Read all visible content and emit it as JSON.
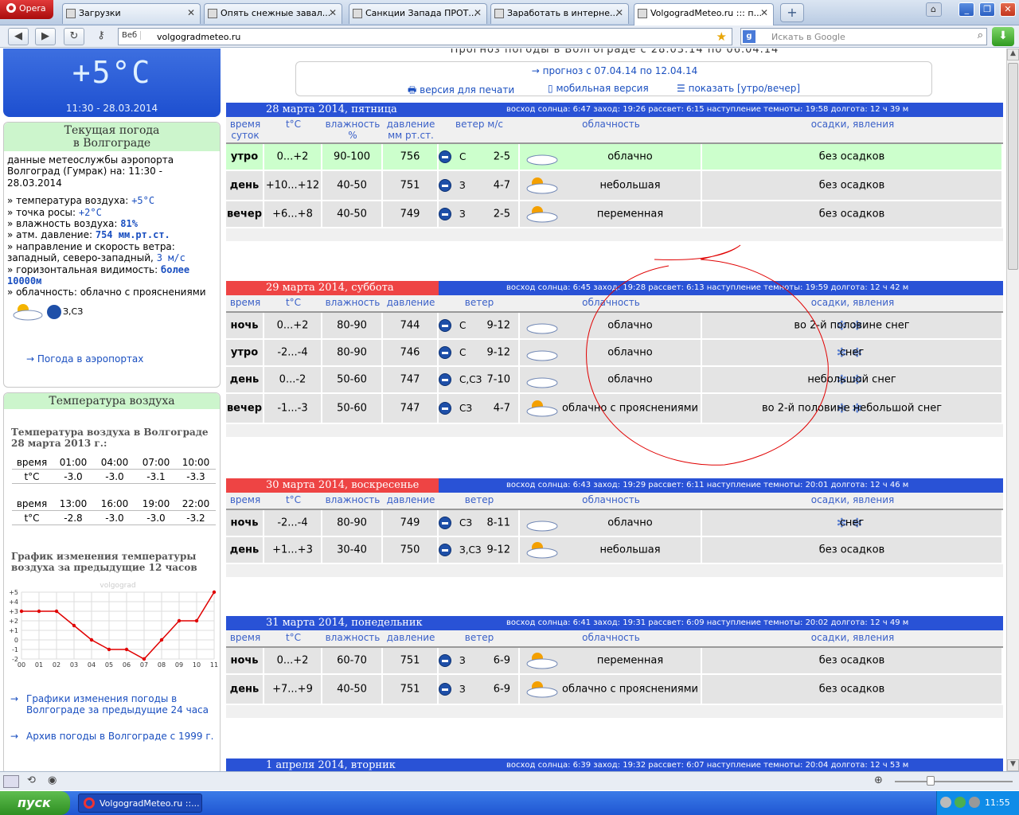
{
  "browser": {
    "opera_label": "Opera",
    "tabs": [
      {
        "title": "Загрузки",
        "active": false
      },
      {
        "title": "Опять снежные завал...",
        "active": false
      },
      {
        "title": "Санкции Запада ПРОТ...",
        "active": false
      },
      {
        "title": "Заработать в интерне...",
        "active": false
      },
      {
        "title": "VolgogradMeteo.ru ::: п...",
        "active": true
      }
    ],
    "web_label": "Веб",
    "url": "volgogradmeteo.ru",
    "search_placeholder": "Искать в Google"
  },
  "page": {
    "top_title": "Прогноз погоды в Волгограде с 28.03.14 по 06.04.14",
    "forecast_next_link": "прогноз с 07.04.14 по 12.04.14",
    "print_link": "версия для печати",
    "mobile_link": "мобильная версия",
    "show_link": "показать [утро/вечер]"
  },
  "current": {
    "big_temp": "+5°C",
    "big_time": "11:30 - 28.03.2014",
    "box_title_1": "Текущая погода",
    "box_title_2": "в Волгограде",
    "source": "данные метеослужбы аэропорта Волгоград (Гумрак) на: 11:30 - 28.03.2014",
    "air_temp_label": "температура воздуха:",
    "air_temp_value": "+5°C",
    "dew_label": "точка росы:",
    "dew_value": "+2°C",
    "humidity_label": "влажность воздуха:",
    "humidity_value": "81%",
    "pressure_label": "атм. давление:",
    "pressure_value": "754 мм.рт.ст.",
    "wind_label": "направление и скорость ветра:",
    "wind_text": "западный, северо-западный,",
    "wind_value": "3 м/с",
    "visibility_label": "горизонтальная видимость:",
    "visibility_value": "более 10000м",
    "cloud_label": "облачность: облачно с прояснениями",
    "wind_dir_short": "З,СЗ",
    "airports_link": "Погода в аэропортах"
  },
  "temp_history": {
    "box_title": "Температура воздуха",
    "subtitle": "Температура воздуха в Волгограде 28 марта 2013 г.:",
    "rows": [
      {
        "label": "время",
        "values": [
          "01:00",
          "04:00",
          "07:00",
          "10:00"
        ]
      },
      {
        "label": "t°C",
        "values": [
          "-3.0",
          "-3.0",
          "-3.1",
          "-3.3"
        ]
      },
      {
        "label": "время",
        "values": [
          "13:00",
          "16:00",
          "19:00",
          "22:00"
        ]
      },
      {
        "label": "t°C",
        "values": [
          "-2.8",
          "-3.0",
          "-3.0",
          "-3.2"
        ]
      }
    ],
    "graph_title": "График изменения температуры воздуха за предыдущие 12 часов",
    "graph_watermark": "volgograd",
    "link_24h": "Графики изменения погоды в Волгограде за предыдущие 24 часа",
    "link_archive": "Архив погоды в Волгограде с 1999 г."
  },
  "chart_data": {
    "type": "line",
    "x": [
      "00",
      "01",
      "02",
      "03",
      "04",
      "05",
      "06",
      "07",
      "08",
      "09",
      "10",
      "11"
    ],
    "values": [
      3,
      3,
      3,
      1.5,
      0,
      -1,
      -1,
      -2,
      0,
      2,
      2,
      5
    ],
    "yticks": [
      "+5",
      "+4",
      "+3",
      "+2",
      "+1",
      "0",
      "-1",
      "-2"
    ],
    "ylim": [
      -2,
      5
    ],
    "color": "#e00000"
  },
  "days": [
    {
      "title": "28 марта 2014, пятница",
      "red": false,
      "sun": "восход солнца: 6:47   заход: 19:26   рассвет: 6:15   наступление темноты: 19:58   долгота: 12 ч 39 м",
      "headers": [
        "время суток",
        "t°C",
        "влажность %",
        "давление мм рт.ст.",
        "ветер м/с",
        "облачность",
        "осадки, явления"
      ],
      "rows": [
        {
          "time": "утро",
          "temp": "0...+2",
          "hum": "90-100",
          "press": "756",
          "wdir": "С",
          "wspd": "2-5",
          "cloud": "облачно",
          "precip": "без осадков",
          "hl": true,
          "snow": false
        },
        {
          "time": "день",
          "temp": "+10...+12",
          "hum": "40-50",
          "press": "751",
          "wdir": "З",
          "wspd": "4-7",
          "cloud": "небольшая",
          "precip": "без осадков",
          "hl": false,
          "snow": false
        },
        {
          "time": "вечер",
          "temp": "+6...+8",
          "hum": "40-50",
          "press": "749",
          "wdir": "З",
          "wspd": "2-5",
          "cloud": "переменная",
          "precip": "без осадков",
          "hl": false,
          "snow": false
        }
      ]
    },
    {
      "title": "29 марта 2014, суббота",
      "red": true,
      "sun": "восход солнца: 6:45   заход: 19:28   рассвет: 6:13   наступление темноты: 19:59   долгота: 12 ч 42 м",
      "headers": [
        "время",
        "t°C",
        "влажность",
        "давление",
        "ветер",
        "облачность",
        "осадки, явления"
      ],
      "rows": [
        {
          "time": "ночь",
          "temp": "0...+2",
          "hum": "80-90",
          "press": "744",
          "wdir": "С",
          "wspd": "9-12",
          "cloud": "облачно",
          "precip": "во 2-й половине снег",
          "hl": false,
          "snow": true
        },
        {
          "time": "утро",
          "temp": "-2...-4",
          "hum": "80-90",
          "press": "746",
          "wdir": "С",
          "wspd": "9-12",
          "cloud": "облачно",
          "precip": "снег",
          "hl": false,
          "snow": true
        },
        {
          "time": "день",
          "temp": "0...-2",
          "hum": "50-60",
          "press": "747",
          "wdir": "С,СЗ",
          "wspd": "7-10",
          "cloud": "облачно",
          "precip": "небольшой снег",
          "hl": false,
          "snow": true
        },
        {
          "time": "вечер",
          "temp": "-1...-3",
          "hum": "50-60",
          "press": "747",
          "wdir": "СЗ",
          "wspd": "4-7",
          "cloud": "облачно с прояснениями",
          "precip": "во 2-й половине небольшой снег",
          "hl": false,
          "snow": true
        }
      ]
    },
    {
      "title": "30 марта 2014, воскресенье",
      "red": true,
      "sun": "восход солнца: 6:43   заход: 19:29   рассвет: 6:11   наступление темноты: 20:01   долгота: 12 ч 46 м",
      "headers": [
        "время",
        "t°C",
        "влажность",
        "давление",
        "ветер",
        "облачность",
        "осадки, явления"
      ],
      "rows": [
        {
          "time": "ночь",
          "temp": "-2...-4",
          "hum": "80-90",
          "press": "749",
          "wdir": "СЗ",
          "wspd": "8-11",
          "cloud": "облачно",
          "precip": "снег",
          "hl": false,
          "snow": true
        },
        {
          "time": "день",
          "temp": "+1...+3",
          "hum": "30-40",
          "press": "750",
          "wdir": "З,СЗ",
          "wspd": "9-12",
          "cloud": "небольшая",
          "precip": "без осадков",
          "hl": false,
          "snow": false
        }
      ]
    },
    {
      "title": "31 марта 2014, понедельник",
      "red": false,
      "sun": "восход солнца: 6:41   заход: 19:31   рассвет: 6:09   наступление темноты: 20:02   долгота: 12 ч 49 м",
      "headers": [
        "время",
        "t°C",
        "влажность",
        "давление",
        "ветер",
        "облачность",
        "осадки, явления"
      ],
      "rows": [
        {
          "time": "ночь",
          "temp": "0...+2",
          "hum": "60-70",
          "press": "751",
          "wdir": "З",
          "wspd": "6-9",
          "cloud": "переменная",
          "precip": "без осадков",
          "hl": false,
          "snow": false
        },
        {
          "time": "день",
          "temp": "+7...+9",
          "hum": "40-50",
          "press": "751",
          "wdir": "З",
          "wspd": "6-9",
          "cloud": "облачно с прояснениями",
          "precip": "без осадков",
          "hl": false,
          "snow": false
        }
      ]
    },
    {
      "title": "1 апреля 2014, вторник",
      "red": false,
      "sun": "восход солнца: 6:39   заход: 19:32   рассвет: 6:07   наступление темноты: 20:04   долгота: 12 ч 53 м",
      "headers": [],
      "rows": []
    }
  ],
  "taskbar": {
    "start_label": "пуск",
    "task_title": "VolgogradMeteo.ru ::...",
    "clock": "11:55"
  }
}
